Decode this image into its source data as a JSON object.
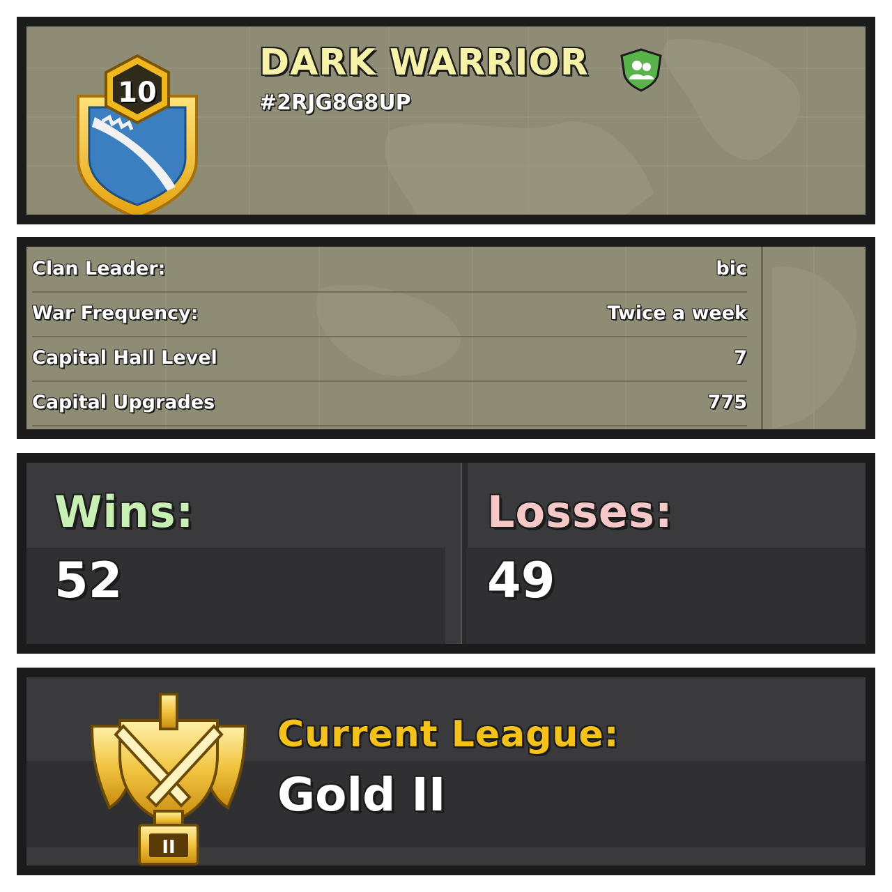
{
  "clan": {
    "level": "10",
    "name": "DARK WARRIOR",
    "tag": "#2RJG8G8UP",
    "badge_icon": "clan-badge-shield-icon",
    "type_icon": "family-friendly-icon"
  },
  "info": [
    {
      "label": "Clan Leader:",
      "value": "bic"
    },
    {
      "label": "War Frequency:",
      "value": "Twice a week"
    },
    {
      "label": "Capital Hall Level",
      "value": "7"
    },
    {
      "label": "Capital Upgrades",
      "value": "775"
    }
  ],
  "war": {
    "wins_label": "Wins:",
    "wins_value": "52",
    "losses_label": "Losses:",
    "losses_value": "49"
  },
  "league": {
    "label": "Current League:",
    "value": "Gold II",
    "badge_numeral": "II",
    "icon": "gold-league-trophy-icon"
  },
  "colors": {
    "map_panel": "#8f8c76",
    "dark_panel": "#3a3a3d",
    "name_yellow": "#f6f2a8",
    "wins_green": "#c9f0b4",
    "losses_pink": "#f7c8c8",
    "league_gold": "#f4c21a"
  }
}
